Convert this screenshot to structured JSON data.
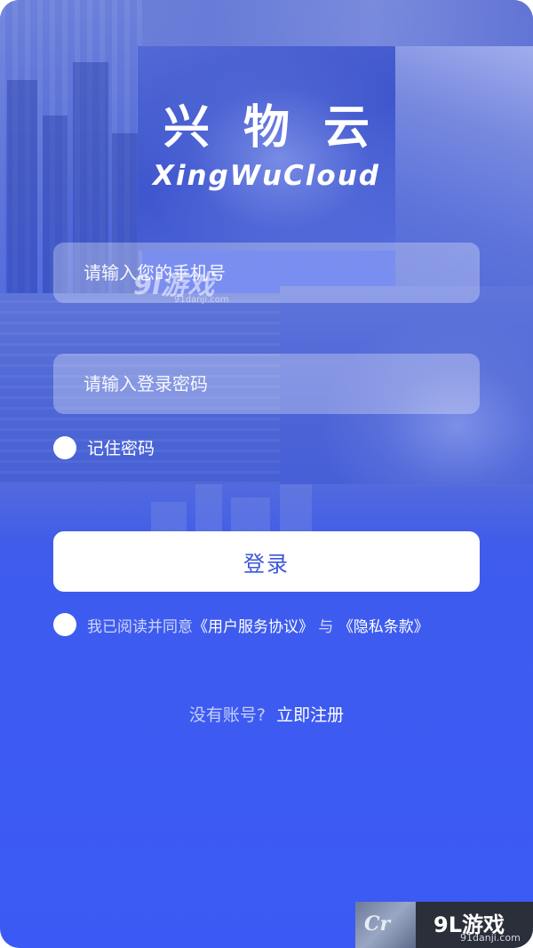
{
  "logo": {
    "title_cn": "兴物云",
    "title_en": "XingWuCloud"
  },
  "form": {
    "phone_placeholder": "请输入您的手机号",
    "password_placeholder": "请输入登录密码",
    "remember_label": "记住密码",
    "login_label": "登录"
  },
  "agreement": {
    "prefix": "我已阅读并同意",
    "user_agreement": "《用户服务协议》",
    "conjunction": "与",
    "privacy_policy": "《隐私条款》"
  },
  "register": {
    "hint": "没有账号?",
    "link": "立即注册"
  },
  "watermark": {
    "mid_big": "9l游戏",
    "mid_small": "91danji.com",
    "chip_letters": "Cr",
    "brand": "9L游戏",
    "domain": "91danji.com"
  },
  "colors": {
    "primary": "#3f5cf0",
    "button_text": "#3a56d8"
  }
}
